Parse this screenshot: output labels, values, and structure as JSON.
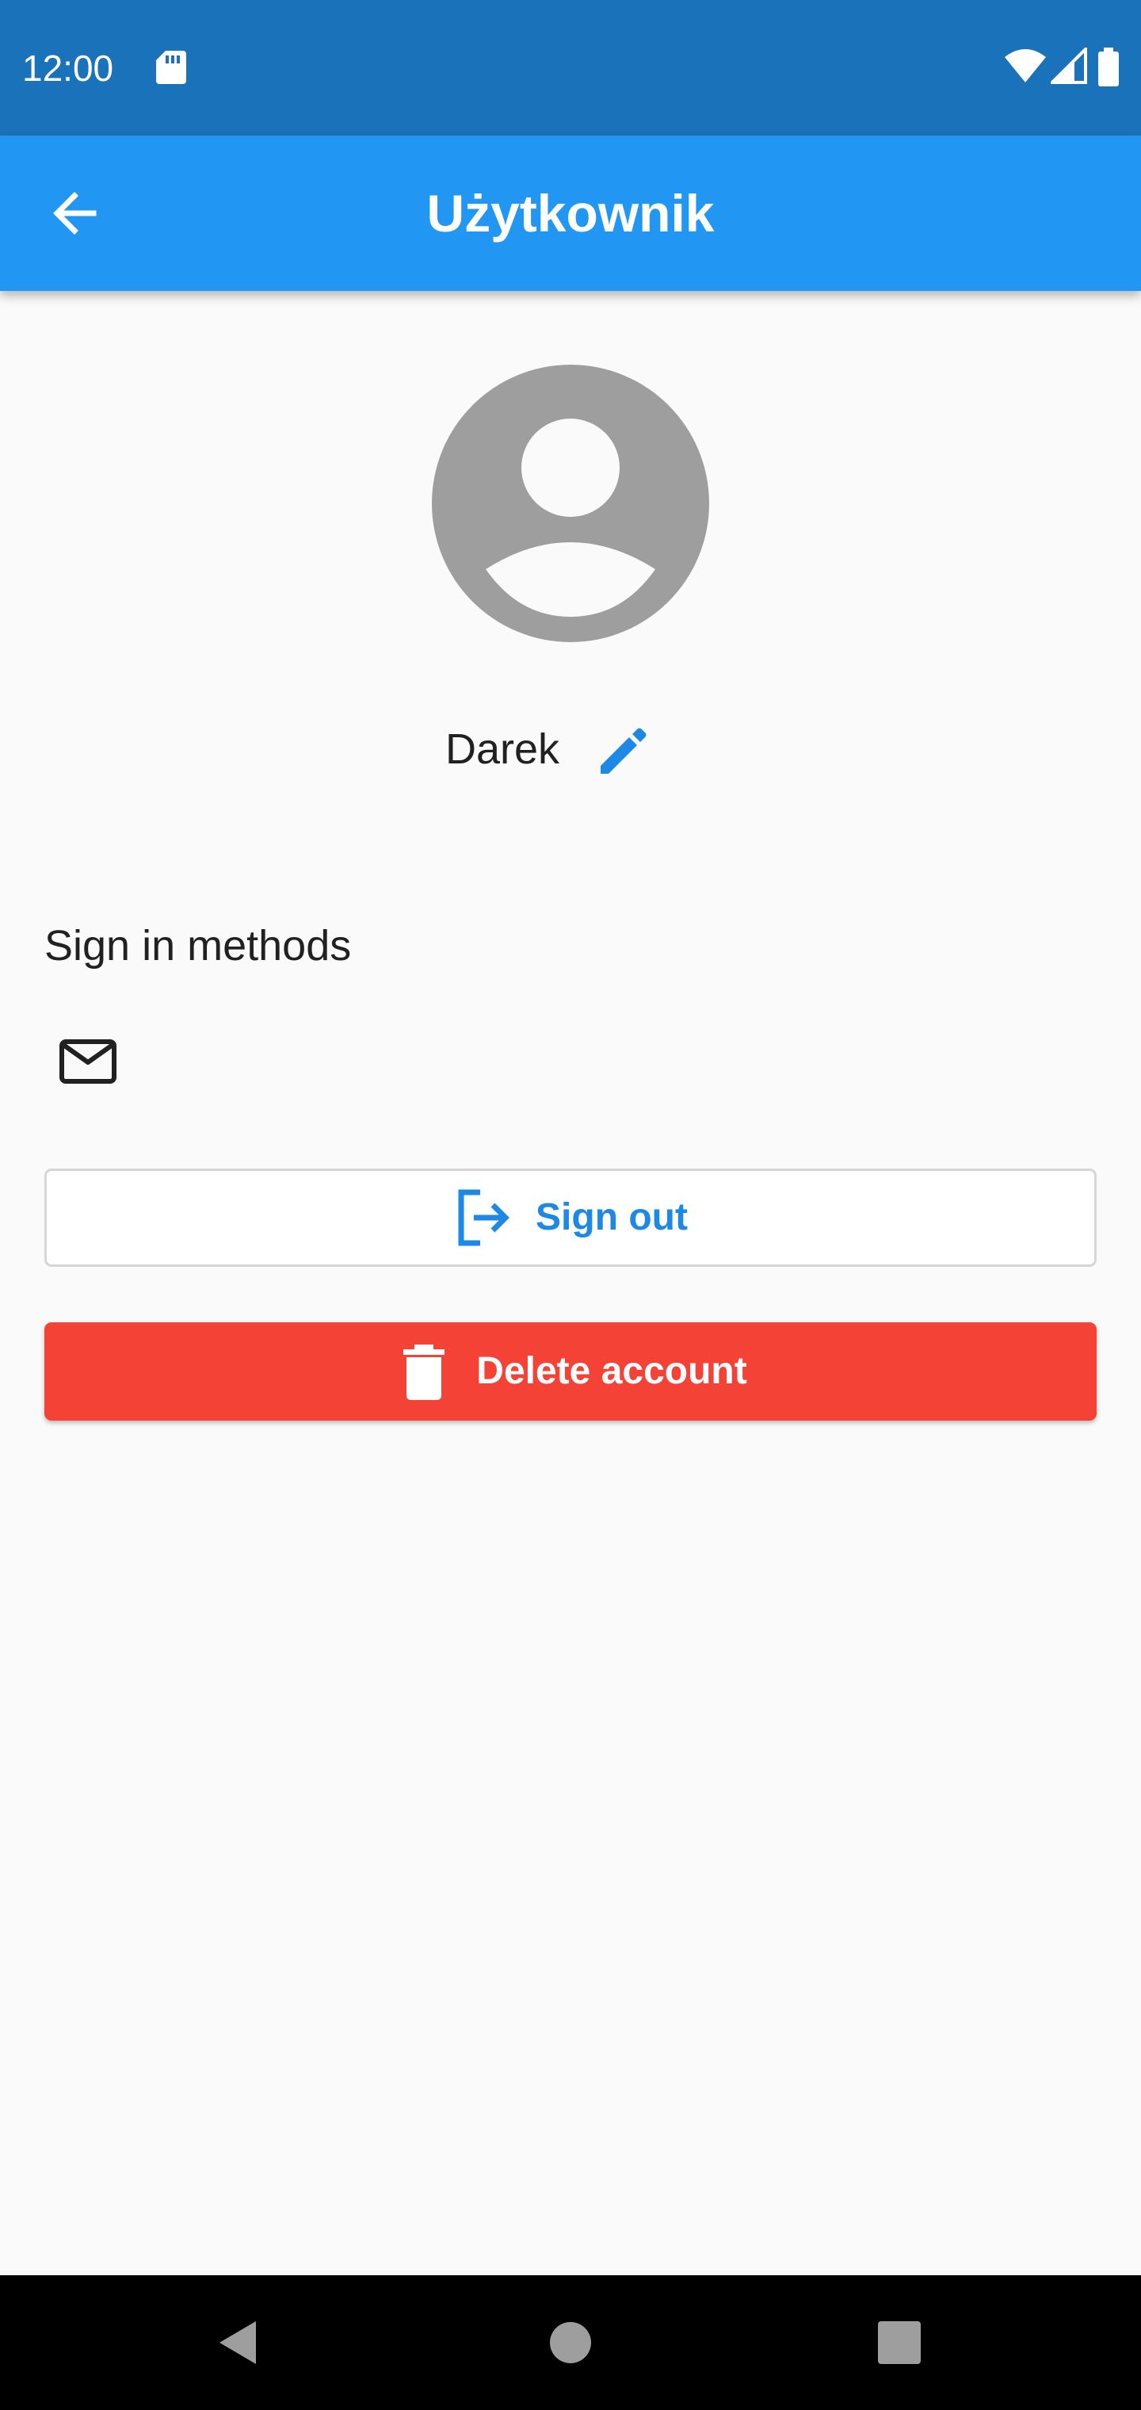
{
  "status_bar": {
    "time": "12:00",
    "icons": [
      "sd-card-icon",
      "wifi-icon",
      "signal-icon",
      "battery-icon"
    ]
  },
  "app_bar": {
    "title": "Użytkownik",
    "back_icon": "arrow-back-icon"
  },
  "profile": {
    "avatar_icon": "account-circle-icon",
    "name": "Darek",
    "edit_icon": "pencil-icon"
  },
  "sign_in_methods": {
    "title": "Sign in methods",
    "methods": [
      "email-icon"
    ]
  },
  "actions": {
    "sign_out_label": "Sign out",
    "sign_out_icon": "logout-icon",
    "delete_label": "Delete account",
    "delete_icon": "trash-icon"
  },
  "colors": {
    "status_bar": "#1a72bb",
    "app_bar": "#2196f3",
    "primary_text_on_button": "#1e88e5",
    "delete": "#f44336",
    "avatar": "#9e9e9e",
    "background": "#fafafa"
  },
  "nav_bar": {
    "buttons": [
      "back-triangle-icon",
      "home-circle-icon",
      "recents-square-icon"
    ]
  }
}
